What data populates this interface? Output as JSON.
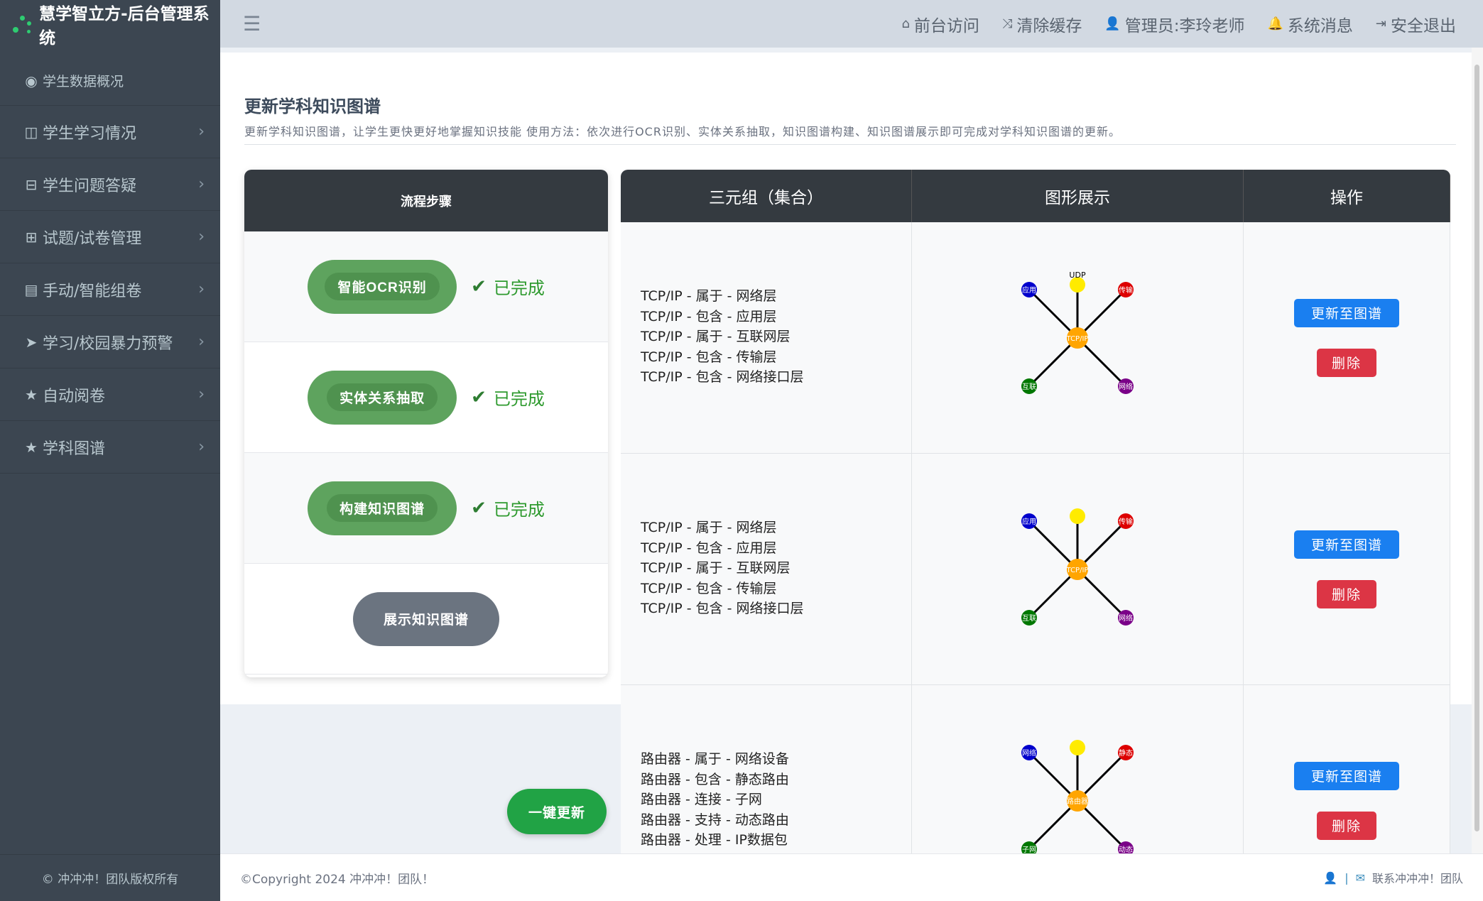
{
  "app": {
    "title": "慧学智立方-后台管理系统"
  },
  "sidebar": {
    "items": [
      {
        "label": "学生数据概况",
        "icon": "dashboard-icon",
        "glyph": "◉"
      },
      {
        "label": "学生学习情况",
        "icon": "columns-icon",
        "glyph": "◫"
      },
      {
        "label": "学生问题答疑",
        "icon": "inbox-icon",
        "glyph": "⊟"
      },
      {
        "label": "试题/试卷管理",
        "icon": "table-icon",
        "glyph": "⊞"
      },
      {
        "label": "手动/智能组卷",
        "icon": "list-alt-icon",
        "glyph": "▤"
      },
      {
        "label": "学习/校园暴力预警",
        "icon": "tags-icon",
        "glyph": "➤"
      },
      {
        "label": "自动阅卷",
        "icon": "star-icon",
        "glyph": "★"
      },
      {
        "label": "学科图谱",
        "icon": "star-icon",
        "glyph": "★"
      }
    ],
    "footer": "© 冲冲冲！团队版权所有"
  },
  "topbar": {
    "links": [
      {
        "label": "前台访问",
        "icon": "home-icon",
        "glyph": "⌂"
      },
      {
        "label": "清除缓存",
        "icon": "random-icon",
        "glyph": "⤨"
      },
      {
        "label": "管理员:李玲老师",
        "icon": "user-icon",
        "glyph": "👤"
      },
      {
        "label": "系统消息",
        "icon": "bell-icon",
        "glyph": "🔔"
      },
      {
        "label": "安全退出",
        "icon": "sign-out-icon",
        "glyph": "⇥"
      }
    ]
  },
  "page": {
    "title": "更新学科知识图谱",
    "desc": "更新学科知识图谱，让学生更快更好地掌握知识技能 使用方法：依次进行OCR识别、实体关系抽取，知识图谱构建、知识图谱展示即可完成对学科知识图谱的更新。"
  },
  "steps": {
    "header": "流程步骤",
    "items": [
      {
        "label": "智能OCR识别",
        "status": "已完成"
      },
      {
        "label": "实体关系抽取",
        "status": "已完成"
      },
      {
        "label": "构建知识图谱",
        "status": "已完成"
      },
      {
        "label": "展示知识图谱",
        "status": ""
      }
    ]
  },
  "table": {
    "headers": [
      "三元组（集合）",
      "图形展示",
      "操作"
    ],
    "update_label": "更新至图谱",
    "delete_label": "删除",
    "rows": [
      {
        "triples": [
          "TCP/IP - 属于 - 网络层",
          "TCP/IP - 包含 - 应用层",
          "TCP/IP - 属于 - 互联网层",
          "TCP/IP - 包含 - 传输层",
          "TCP/IP - 包含 - 网络接口层"
        ]
      },
      {
        "triples": [
          "TCP/IP - 属于 - 网络层",
          "TCP/IP - 包含 - 应用层",
          "TCP/IP - 属于 - 互联网层",
          "TCP/IP - 包含 - 传输层",
          "TCP/IP - 包含 - 网络接口层"
        ]
      },
      {
        "triples": [
          "路由器 - 属于 - 网络设备",
          "路由器 - 包含 - 静态路由",
          "路由器 - 连接 - 子网",
          "路由器 - 支持 - 动态路由",
          "路由器 - 处理 - IP数据包"
        ]
      }
    ]
  },
  "graphs": [
    {
      "top": "UDP",
      "tl": "应用",
      "tr": "传输",
      "bl": "互联",
      "br": "网络",
      "center": "TCP/IP"
    },
    {
      "top": "",
      "tl": "应用",
      "tr": "传输",
      "bl": "互联",
      "br": "网络",
      "center": "TCP/IP"
    },
    {
      "top": "",
      "tl": "网络",
      "tr": "静态",
      "bl": "子网",
      "br": "动态",
      "center": "路由器"
    }
  ],
  "onekey_label": "一键更新",
  "footer": {
    "copyright": "©Copyright 2024 冲冲冲！团队！",
    "contact": "联系冲冲冲！团队"
  },
  "colors": {
    "sidebar": "#3c4651",
    "topbar": "#d2d9e2",
    "primary": "#1a7ff0",
    "danger": "#dc3545",
    "success": "#5ea35e"
  }
}
